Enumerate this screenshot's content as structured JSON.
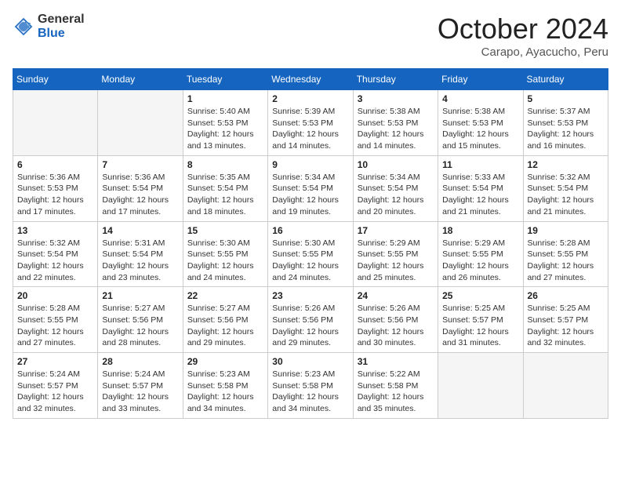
{
  "header": {
    "logo_general": "General",
    "logo_blue": "Blue",
    "month": "October 2024",
    "location": "Carapo, Ayacucho, Peru"
  },
  "weekdays": [
    "Sunday",
    "Monday",
    "Tuesday",
    "Wednesday",
    "Thursday",
    "Friday",
    "Saturday"
  ],
  "weeks": [
    [
      {
        "day": "",
        "info": ""
      },
      {
        "day": "",
        "info": ""
      },
      {
        "day": "1",
        "info": "Sunrise: 5:40 AM\nSunset: 5:53 PM\nDaylight: 12 hours and 13 minutes."
      },
      {
        "day": "2",
        "info": "Sunrise: 5:39 AM\nSunset: 5:53 PM\nDaylight: 12 hours and 14 minutes."
      },
      {
        "day": "3",
        "info": "Sunrise: 5:38 AM\nSunset: 5:53 PM\nDaylight: 12 hours and 14 minutes."
      },
      {
        "day": "4",
        "info": "Sunrise: 5:38 AM\nSunset: 5:53 PM\nDaylight: 12 hours and 15 minutes."
      },
      {
        "day": "5",
        "info": "Sunrise: 5:37 AM\nSunset: 5:53 PM\nDaylight: 12 hours and 16 minutes."
      }
    ],
    [
      {
        "day": "6",
        "info": "Sunrise: 5:36 AM\nSunset: 5:53 PM\nDaylight: 12 hours and 17 minutes."
      },
      {
        "day": "7",
        "info": "Sunrise: 5:36 AM\nSunset: 5:54 PM\nDaylight: 12 hours and 17 minutes."
      },
      {
        "day": "8",
        "info": "Sunrise: 5:35 AM\nSunset: 5:54 PM\nDaylight: 12 hours and 18 minutes."
      },
      {
        "day": "9",
        "info": "Sunrise: 5:34 AM\nSunset: 5:54 PM\nDaylight: 12 hours and 19 minutes."
      },
      {
        "day": "10",
        "info": "Sunrise: 5:34 AM\nSunset: 5:54 PM\nDaylight: 12 hours and 20 minutes."
      },
      {
        "day": "11",
        "info": "Sunrise: 5:33 AM\nSunset: 5:54 PM\nDaylight: 12 hours and 21 minutes."
      },
      {
        "day": "12",
        "info": "Sunrise: 5:32 AM\nSunset: 5:54 PM\nDaylight: 12 hours and 21 minutes."
      }
    ],
    [
      {
        "day": "13",
        "info": "Sunrise: 5:32 AM\nSunset: 5:54 PM\nDaylight: 12 hours and 22 minutes."
      },
      {
        "day": "14",
        "info": "Sunrise: 5:31 AM\nSunset: 5:54 PM\nDaylight: 12 hours and 23 minutes."
      },
      {
        "day": "15",
        "info": "Sunrise: 5:30 AM\nSunset: 5:55 PM\nDaylight: 12 hours and 24 minutes."
      },
      {
        "day": "16",
        "info": "Sunrise: 5:30 AM\nSunset: 5:55 PM\nDaylight: 12 hours and 24 minutes."
      },
      {
        "day": "17",
        "info": "Sunrise: 5:29 AM\nSunset: 5:55 PM\nDaylight: 12 hours and 25 minutes."
      },
      {
        "day": "18",
        "info": "Sunrise: 5:29 AM\nSunset: 5:55 PM\nDaylight: 12 hours and 26 minutes."
      },
      {
        "day": "19",
        "info": "Sunrise: 5:28 AM\nSunset: 5:55 PM\nDaylight: 12 hours and 27 minutes."
      }
    ],
    [
      {
        "day": "20",
        "info": "Sunrise: 5:28 AM\nSunset: 5:55 PM\nDaylight: 12 hours and 27 minutes."
      },
      {
        "day": "21",
        "info": "Sunrise: 5:27 AM\nSunset: 5:56 PM\nDaylight: 12 hours and 28 minutes."
      },
      {
        "day": "22",
        "info": "Sunrise: 5:27 AM\nSunset: 5:56 PM\nDaylight: 12 hours and 29 minutes."
      },
      {
        "day": "23",
        "info": "Sunrise: 5:26 AM\nSunset: 5:56 PM\nDaylight: 12 hours and 29 minutes."
      },
      {
        "day": "24",
        "info": "Sunrise: 5:26 AM\nSunset: 5:56 PM\nDaylight: 12 hours and 30 minutes."
      },
      {
        "day": "25",
        "info": "Sunrise: 5:25 AM\nSunset: 5:57 PM\nDaylight: 12 hours and 31 minutes."
      },
      {
        "day": "26",
        "info": "Sunrise: 5:25 AM\nSunset: 5:57 PM\nDaylight: 12 hours and 32 minutes."
      }
    ],
    [
      {
        "day": "27",
        "info": "Sunrise: 5:24 AM\nSunset: 5:57 PM\nDaylight: 12 hours and 32 minutes."
      },
      {
        "day": "28",
        "info": "Sunrise: 5:24 AM\nSunset: 5:57 PM\nDaylight: 12 hours and 33 minutes."
      },
      {
        "day": "29",
        "info": "Sunrise: 5:23 AM\nSunset: 5:58 PM\nDaylight: 12 hours and 34 minutes."
      },
      {
        "day": "30",
        "info": "Sunrise: 5:23 AM\nSunset: 5:58 PM\nDaylight: 12 hours and 34 minutes."
      },
      {
        "day": "31",
        "info": "Sunrise: 5:22 AM\nSunset: 5:58 PM\nDaylight: 12 hours and 35 minutes."
      },
      {
        "day": "",
        "info": ""
      },
      {
        "day": "",
        "info": ""
      }
    ]
  ]
}
